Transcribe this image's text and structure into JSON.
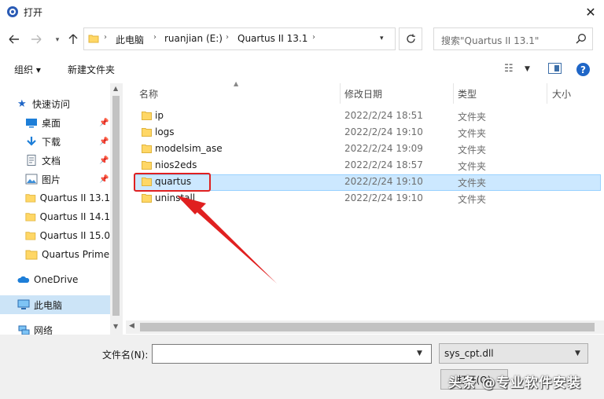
{
  "window": {
    "title": "打开",
    "close": "✕"
  },
  "address": {
    "crumbs": [
      "此电脑",
      "ruanjian (E:)",
      "Quartus II 13.1"
    ],
    "search_placeholder": "搜索\"Quartus II 13.1\""
  },
  "toolbar": {
    "organize": "组织 ▾",
    "new_folder": "新建文件夹"
  },
  "nav": {
    "quick_access": "快速访问",
    "items": [
      {
        "label": "桌面",
        "icon": "desktop-icon",
        "pinned": true
      },
      {
        "label": "下载",
        "icon": "download-icon",
        "pinned": true
      },
      {
        "label": "文档",
        "icon": "document-icon",
        "pinned": true
      },
      {
        "label": "图片",
        "icon": "picture-icon",
        "pinned": true
      },
      {
        "label": "Quartus II 13.1",
        "icon": "folder-icon"
      },
      {
        "label": "Quartus II 14.1",
        "icon": "folder-icon"
      },
      {
        "label": "Quartus II 15.0",
        "icon": "folder-icon"
      },
      {
        "label": "Quartus Prime",
        "icon": "folder-icon"
      }
    ],
    "onedrive": "OneDrive",
    "this_pc": "此电脑",
    "network": "网络"
  },
  "columns": {
    "name": "名称",
    "date": "修改日期",
    "type": "类型",
    "size": "大小"
  },
  "files": [
    {
      "name": "ip",
      "date": "2022/2/24 18:51",
      "type": "文件夹"
    },
    {
      "name": "logs",
      "date": "2022/2/24 19:10",
      "type": "文件夹"
    },
    {
      "name": "modelsim_ase",
      "date": "2022/2/24 19:09",
      "type": "文件夹"
    },
    {
      "name": "nios2eds",
      "date": "2022/2/24 18:57",
      "type": "文件夹"
    },
    {
      "name": "quartus",
      "date": "2022/2/24 19:10",
      "type": "文件夹"
    },
    {
      "name": "uninstall",
      "date": "2022/2/24 19:10",
      "type": "文件夹"
    }
  ],
  "selected_file": "quartus",
  "bottom": {
    "filename_label": "文件名(N):",
    "filename_value": "",
    "filetype_value": "sys_cpt.dll",
    "open_label": "打开(O)"
  },
  "watermark": "头条 @专业软件安装",
  "colors": {
    "accent": "#1f66c7",
    "folder": "#ffd766",
    "annotation": "#e02020",
    "selection": "#cce8ff"
  }
}
